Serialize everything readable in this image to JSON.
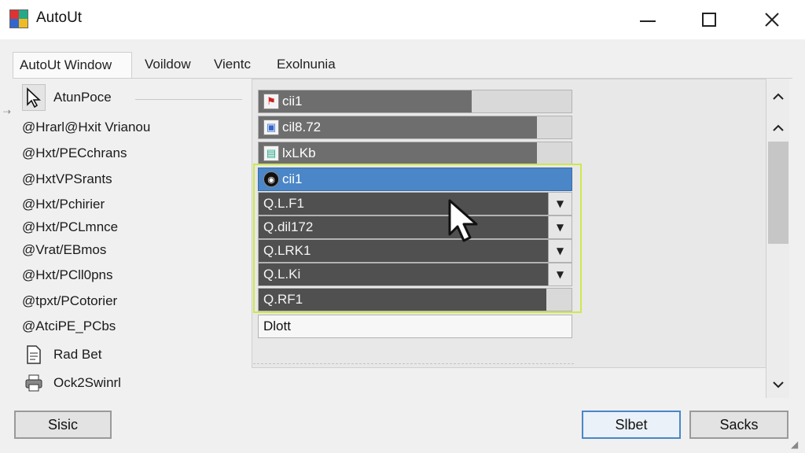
{
  "window": {
    "title": "AutoUt"
  },
  "tabs": [
    {
      "label": "AutoUt Window"
    },
    {
      "label": "Voildow"
    },
    {
      "label": "Vientc"
    },
    {
      "label": "Exolnunia"
    }
  ],
  "left_list": {
    "items": [
      {
        "label": "AtunPoce"
      },
      {
        "label": "@Hrarl@Hxit Vrianou"
      },
      {
        "label": "@Hxt/PECchrans"
      },
      {
        "label": "@HxtVPSrants"
      },
      {
        "label": "@Hxt/Pchirier"
      },
      {
        "label": "@Hxt/PCLmnce"
      },
      {
        "label": "@Vrat/EBmos"
      },
      {
        "label": "@Hxt/PCll0pns"
      },
      {
        "label": "@tpxt/PCotorier"
      },
      {
        "label": "@AtciPE_PCbs"
      },
      {
        "label": "Rad Bet"
      },
      {
        "label": "Ock2Swinrl"
      }
    ]
  },
  "right_list": {
    "rows": [
      {
        "label": "cii1",
        "fill": 0.68
      },
      {
        "label": "cil8.72",
        "fill": 0.89
      },
      {
        "label": "lxLKb",
        "fill": 0.89
      },
      {
        "label": "cii1"
      },
      {
        "label": "Q.L.F1"
      },
      {
        "label": "Q.dil172"
      },
      {
        "label": "Q.LRK1"
      },
      {
        "label": "Q.L.Ki"
      },
      {
        "label": "Q.RF1",
        "fill": 0.92
      }
    ],
    "input_value": "Dlott"
  },
  "buttons": {
    "left": "Sisic",
    "middle": "Slbet",
    "right": "Sacks"
  },
  "colors": {
    "selection": "#4a86c8",
    "highlight": "#cfe84a"
  }
}
